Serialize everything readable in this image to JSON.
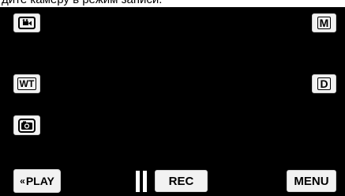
{
  "caption": {
    "text": "дите камеру в режим записи."
  },
  "buttons": {
    "movie_mode": {
      "icon": "video-camera-icon"
    },
    "manual": {
      "label": "M"
    },
    "wt_zoom": {
      "label": "WT"
    },
    "dual_mode": {
      "label": "D"
    },
    "snapshot": {
      "icon": "camera-icon"
    },
    "playback": {
      "label": "PLAY",
      "icon": "double-chevron-left-icon"
    },
    "record": {
      "label": "REC",
      "state_icon": "pause-icon"
    },
    "menu": {
      "label": "MENU"
    }
  },
  "colors": {
    "screen_bg": "#000000",
    "button_bg": "#f2f2f2",
    "pause_icon": "#ffffff"
  }
}
